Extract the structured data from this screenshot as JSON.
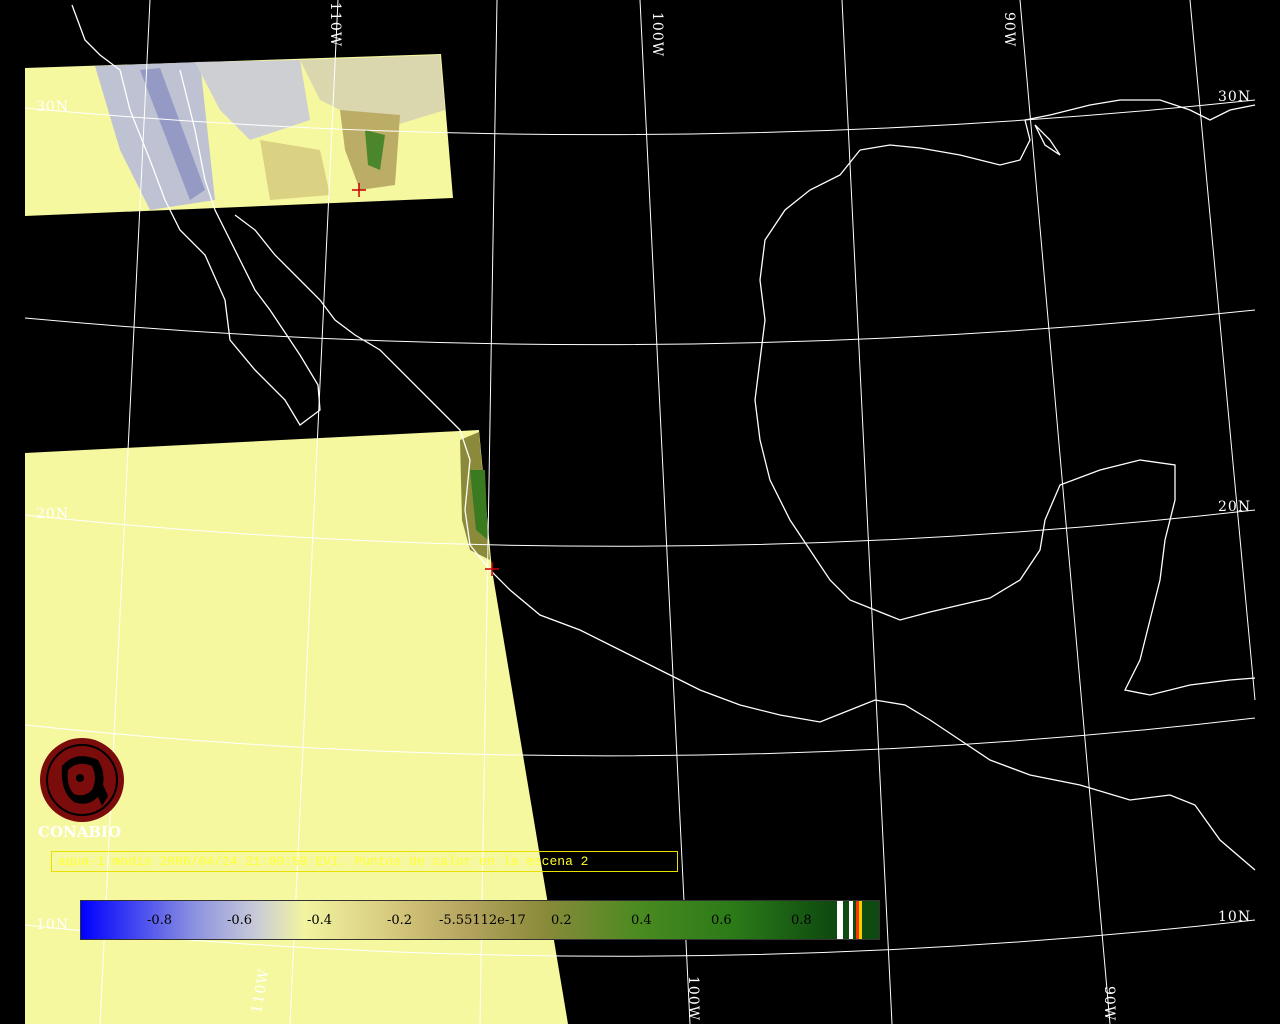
{
  "map": {
    "background_color": "#000000",
    "grid_color": "#ffffff",
    "coast_color": "#ffffff",
    "swath_color": "#f6f8a0",
    "hotspot_color": "#cc0000",
    "lat_labels": [
      "30N",
      "20N",
      "10N"
    ],
    "lon_labels": [
      "110W",
      "100W",
      "90W"
    ]
  },
  "logo": {
    "name": "CONABIO",
    "color": "#7a0c0c"
  },
  "caption": "aqua-1 modis 2006/04/24 21:00:59 EVI. Puntos de calor en la escena 2",
  "colorbar": {
    "ticks": [
      "-0.8",
      "-0.6",
      "-0.4",
      "-0.2",
      "-5.55112e-17",
      "0.2",
      "0.4",
      "0.6",
      "0.8"
    ],
    "end_swatches": [
      "#ffffff",
      "#ffffff",
      "#ff3300",
      "#ffcc00"
    ]
  }
}
